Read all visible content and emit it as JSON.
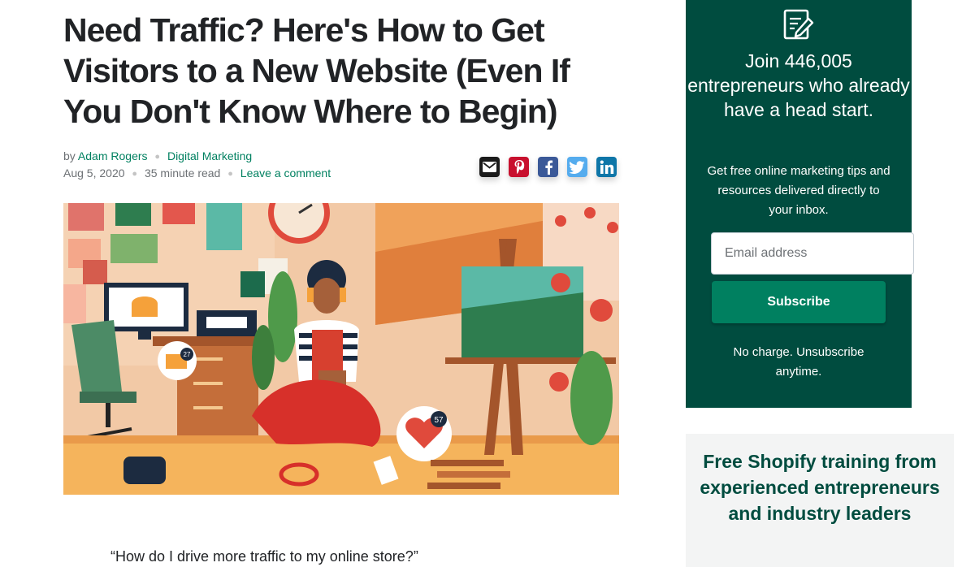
{
  "article": {
    "title": "Need Traffic? Here's How to Get Visitors to a New Website (Even If You Don't Know Where to Begin)",
    "by": "by",
    "author": "Adam Rogers",
    "category": "Digital Marketing",
    "date": "Aug 5, 2020",
    "read_time": "35 minute read",
    "comment_link": "Leave a comment",
    "hero_badges": {
      "basket_count": "27",
      "likes_count": "57"
    },
    "quote": "“How do I drive more traffic to my online store?”"
  },
  "share": [
    {
      "network": "email",
      "icon": "envelope-icon",
      "color": "#1b1b1b"
    },
    {
      "network": "pinterest",
      "icon": "pinterest-icon",
      "color": "#c8102e"
    },
    {
      "network": "facebook",
      "icon": "facebook-icon",
      "color": "#3b5998"
    },
    {
      "network": "twitter",
      "icon": "twitter-icon",
      "color": "#55acee"
    },
    {
      "network": "linkedin",
      "icon": "linkedin-icon",
      "color": "#0e76a8"
    }
  ],
  "signup": {
    "icon": "edit-document-icon",
    "heading": "Join 446,005 entrepreneurs who already have a head start.",
    "subtext": "Get free online marketing tips and resources delivered directly to your inbox.",
    "email_placeholder": "Email address",
    "email_value": "",
    "subscribe_label": "Subscribe",
    "no_charge": "No charge. Unsubscribe anytime.",
    "bg_color": "#004c3f",
    "button_color": "#008060"
  },
  "training": {
    "heading": "Free Shopify training from experienced entrepreneurs and industry leaders"
  },
  "colors": {
    "link": "#008060",
    "text": "#212326",
    "muted": "#6d7175"
  }
}
